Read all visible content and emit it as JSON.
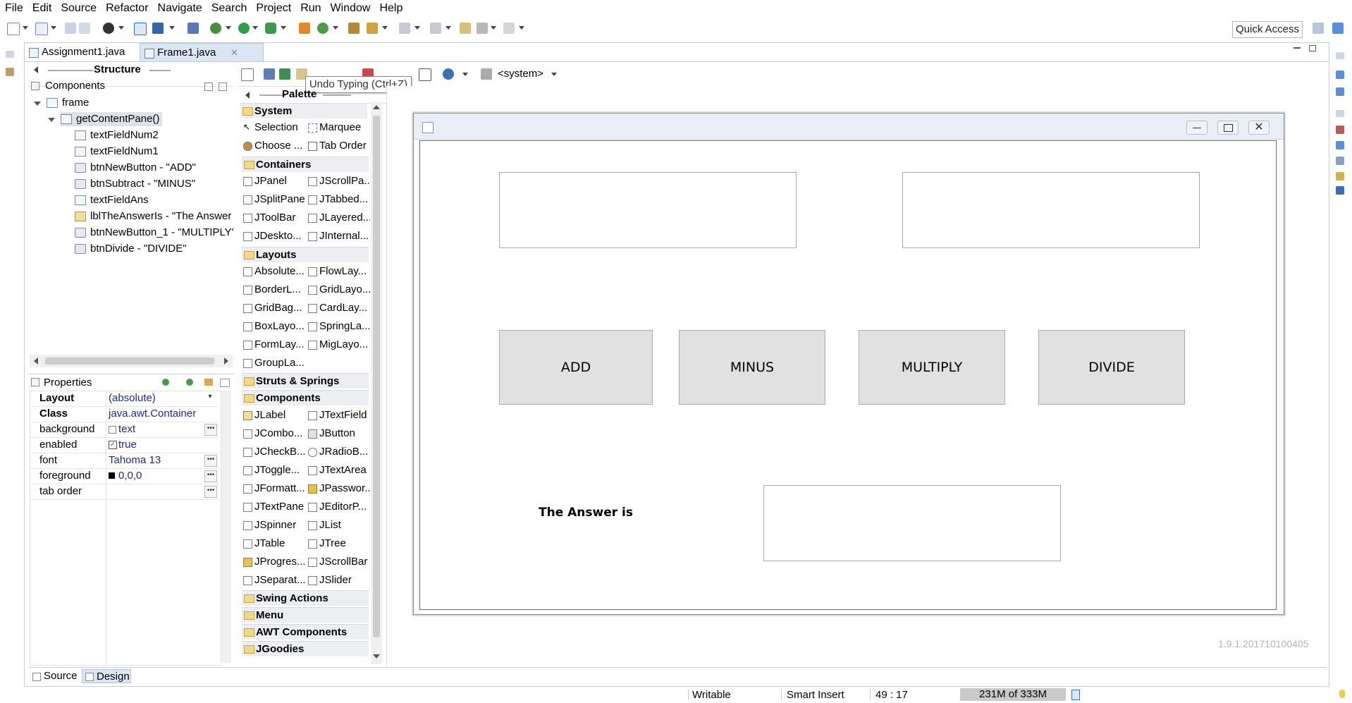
{
  "menu": [
    "File",
    "Edit",
    "Source",
    "Refactor",
    "Navigate",
    "Search",
    "Project",
    "Run",
    "Window",
    "Help"
  ],
  "toolbar": {
    "quick_access": "Quick Access"
  },
  "tabs": [
    {
      "label": "Assignment1.java",
      "active": false
    },
    {
      "label": "Frame1.java",
      "active": true
    }
  ],
  "structure": {
    "title": "Structure",
    "components_label": "Components",
    "tree": [
      {
        "label": "frame",
        "level": 0
      },
      {
        "label": "getContentPane()",
        "level": 1
      },
      {
        "label": "textFieldNum2",
        "level": 2
      },
      {
        "label": "textFieldNum1",
        "level": 2
      },
      {
        "label": "btnNewButton - \"ADD\"",
        "level": 2
      },
      {
        "label": "btnSubtract - \"MINUS\"",
        "level": 2
      },
      {
        "label": "textFieldAns",
        "level": 2
      },
      {
        "label": "lblTheAnswerIs - \"The Answer is",
        "level": 2
      },
      {
        "label": "btnNewButton_1 - \"MULTIPLY\"",
        "level": 2
      },
      {
        "label": "btnDivide - \"DIVIDE\"",
        "level": 2
      }
    ]
  },
  "properties": {
    "title": "Properties",
    "rows": [
      {
        "name": "Layout",
        "value": "(absolute)",
        "bold": true
      },
      {
        "name": "Class",
        "value": "java.awt.Container",
        "bold": true
      },
      {
        "name": "background",
        "value": "text",
        "bold": false
      },
      {
        "name": "enabled",
        "value": "true",
        "bold": false
      },
      {
        "name": "font",
        "value": "Tahoma 13",
        "bold": false
      },
      {
        "name": "foreground",
        "value": "0,0,0",
        "bold": false
      },
      {
        "name": "tab order",
        "value": "",
        "bold": false
      }
    ]
  },
  "editor_toolbar": {
    "system_select": "<system>",
    "tooltip": "Undo Typing (Ctrl+Z)"
  },
  "palette": {
    "title": "Palette",
    "categories": [
      {
        "name": "System",
        "items": [
          "Selection",
          "Marquee",
          "Choose ...",
          "Tab Order"
        ]
      },
      {
        "name": "Containers",
        "items": [
          "JPanel",
          "JScrollPa...",
          "JSplitPane",
          "JTabbed...",
          "JToolBar",
          "JLayered...",
          "JDeskto...",
          "JInternal..."
        ]
      },
      {
        "name": "Layouts",
        "items": [
          "Absolute...",
          "FlowLay...",
          "BorderL...",
          "GridLayo...",
          "GridBag...",
          "CardLay...",
          "BoxLayo...",
          "SpringLa...",
          "FormLay...",
          "MigLayo...",
          "GroupLa..."
        ]
      },
      {
        "name": "Struts & Springs",
        "items": []
      },
      {
        "name": "Components",
        "items": [
          "JLabel",
          "JTextField",
          "JCombo...",
          "JButton",
          "JCheckB...",
          "JRadioB...",
          "JToggle...",
          "JTextArea",
          "JFormatt...",
          "JPasswor...",
          "JTextPane",
          "JEditorP...",
          "JSpinner",
          "JList",
          "JTable",
          "JTree",
          "JProgres...",
          "JScrollBar",
          "JSeparat...",
          "JSlider"
        ]
      },
      {
        "name": "Swing Actions",
        "items": []
      },
      {
        "name": "Menu",
        "items": []
      },
      {
        "name": "AWT Components",
        "items": []
      },
      {
        "name": "JGoodies",
        "items": []
      }
    ]
  },
  "design": {
    "buttons": [
      "ADD",
      "MINUS",
      "MULTIPLY",
      "DIVIDE"
    ],
    "answer_label": "The Answer is",
    "version": "1.9.1.201710100405"
  },
  "bottom_tabs": {
    "source": "Source",
    "design": "Design"
  },
  "status": {
    "writable": "Writable",
    "insert": "Smart Insert",
    "position": "49 : 17",
    "heap": "231M of 333M"
  }
}
